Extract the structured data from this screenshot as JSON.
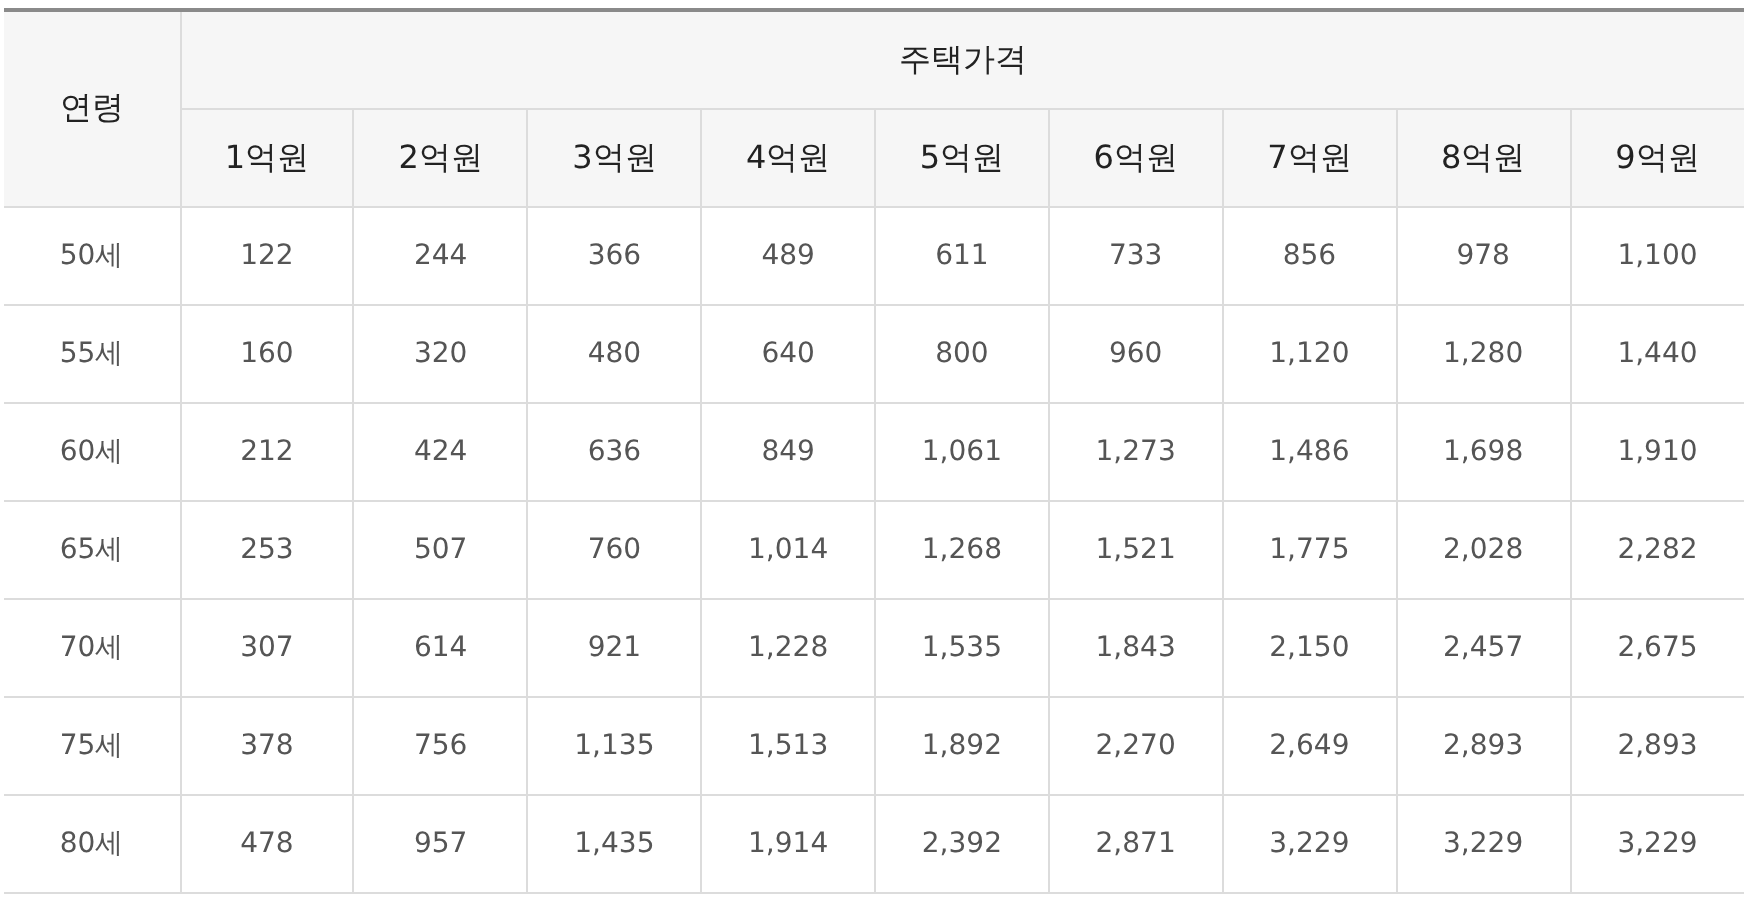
{
  "table": {
    "row_header": "연령",
    "group_header": "주택가격",
    "columns": [
      "1억원",
      "2억원",
      "3억원",
      "4억원",
      "5억원",
      "6억원",
      "7억원",
      "8억원",
      "9억원"
    ],
    "rows": [
      {
        "age": "50세",
        "values": [
          "122",
          "244",
          "366",
          "489",
          "611",
          "733",
          "856",
          "978",
          "1,100"
        ]
      },
      {
        "age": "55세",
        "values": [
          "160",
          "320",
          "480",
          "640",
          "800",
          "960",
          "1,120",
          "1,280",
          "1,440"
        ]
      },
      {
        "age": "60세",
        "values": [
          "212",
          "424",
          "636",
          "849",
          "1,061",
          "1,273",
          "1,486",
          "1,698",
          "1,910"
        ]
      },
      {
        "age": "65세",
        "values": [
          "253",
          "507",
          "760",
          "1,014",
          "1,268",
          "1,521",
          "1,775",
          "2,028",
          "2,282"
        ]
      },
      {
        "age": "70세",
        "values": [
          "307",
          "614",
          "921",
          "1,228",
          "1,535",
          "1,843",
          "2,150",
          "2,457",
          "2,675"
        ]
      },
      {
        "age": "75세",
        "values": [
          "378",
          "756",
          "1,135",
          "1,513",
          "1,892",
          "2,270",
          "2,649",
          "2,893",
          "2,893"
        ]
      },
      {
        "age": "80세",
        "values": [
          "478",
          "957",
          "1,435",
          "1,914",
          "2,392",
          "2,871",
          "3,229",
          "3,229",
          "3,229"
        ]
      }
    ]
  }
}
